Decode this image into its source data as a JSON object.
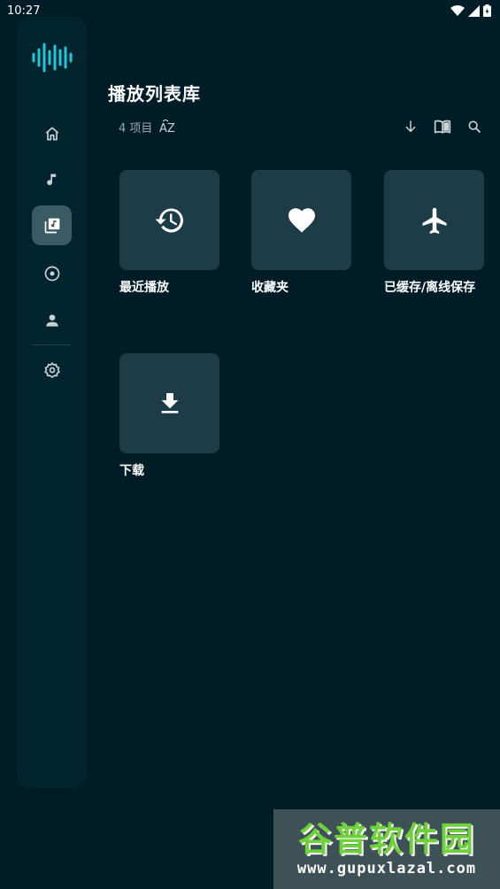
{
  "status_bar": {
    "time": "10:27"
  },
  "nav_rail": {
    "logo_icon": "waveform-icon",
    "items": [
      {
        "icon": "home-icon",
        "active": false
      },
      {
        "icon": "music-note-icon",
        "active": false
      },
      {
        "icon": "library-music-icon",
        "active": true
      },
      {
        "icon": "album-icon",
        "active": false
      },
      {
        "icon": "person-icon",
        "active": false
      },
      {
        "icon": "gear-icon",
        "active": false
      }
    ]
  },
  "header": {
    "title": "播放列表库",
    "item_count": "4 项目",
    "sort_label": "AZ"
  },
  "toolbar": {
    "icons": [
      "arrow-down-icon",
      "book-open-icon",
      "search-icon"
    ]
  },
  "playlists": [
    {
      "label": "最近播放",
      "icon": "history-icon"
    },
    {
      "label": "收藏夹",
      "icon": "heart-icon"
    },
    {
      "label": "已缓存/离线保存",
      "icon": "airplane-icon"
    },
    {
      "label": "下载",
      "icon": "download-icon"
    }
  ],
  "watermark": {
    "title": "谷普软件园",
    "url": "www.gupuxlazal.com"
  },
  "colors": {
    "background": "#001c26",
    "rail": "#02242f",
    "tile": "#1d3c47",
    "accent": "#1ec8d8",
    "watermark_green": "#6fd13a"
  }
}
